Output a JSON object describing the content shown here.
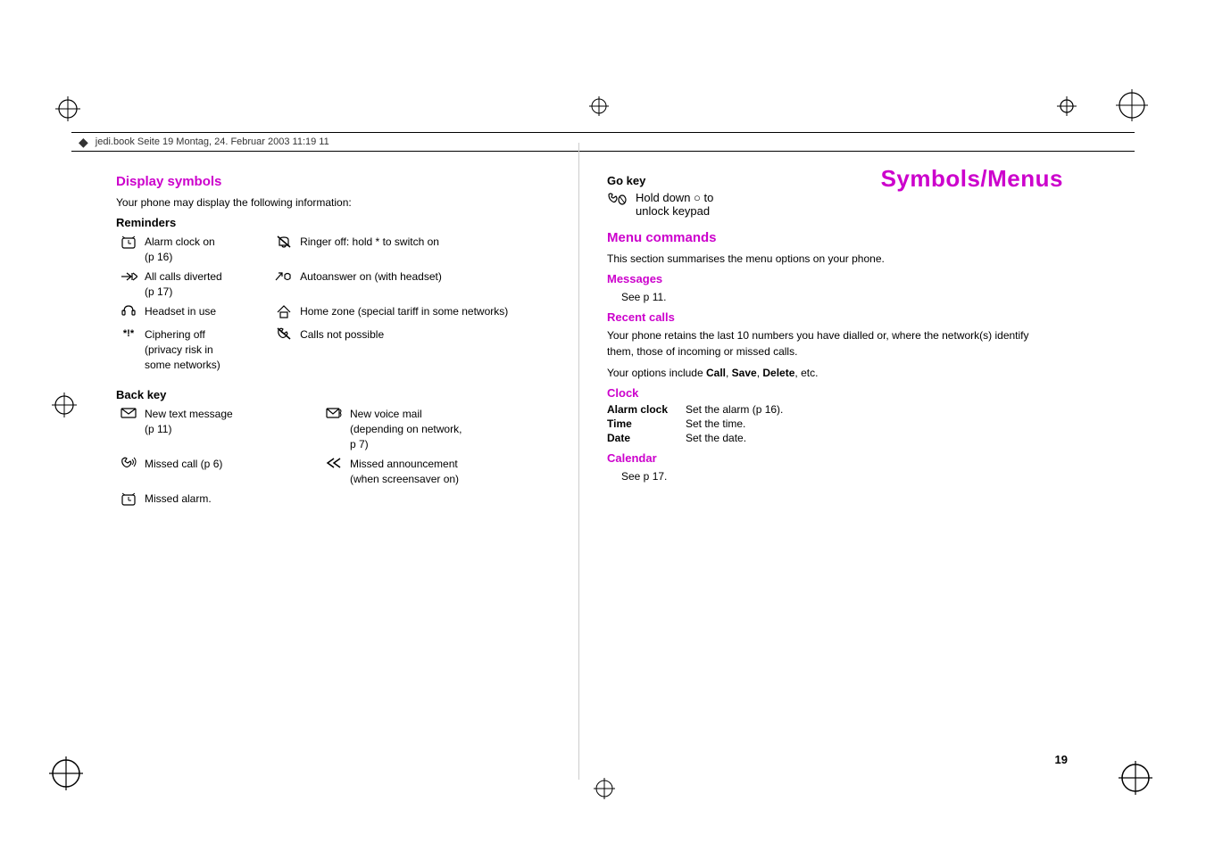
{
  "header": {
    "filename": "jedi.book  Seite 19  Montag, 24. Februar 2003  11:19 11"
  },
  "page_title": "Symbols/Menus",
  "page_number": "19",
  "left": {
    "display_symbols_heading": "Display symbols",
    "intro": "Your phone may display the following information:",
    "reminders_heading": "Reminders",
    "reminders": [
      {
        "icon": "⌚",
        "text": "Alarm clock on\n(p 16)"
      },
      {
        "icon": "✗",
        "text": "Ringer off: hold * to\nswitch on"
      },
      {
        "icon": "↗↗",
        "text": "All calls diverted\n(p 17)"
      },
      {
        "icon": "↗☎",
        "text": "Autoanswer on (with\nheadset)"
      },
      {
        "icon": "🎧",
        "text": "Headset in use"
      },
      {
        "icon": "⌂",
        "text": "Home zone (special tariff\nin some networks)"
      },
      {
        "icon": "*!*",
        "text": "Ciphering off\n(privacy risk in\nsome networks)"
      },
      {
        "icon": "↗",
        "text": "Calls not possible"
      }
    ],
    "backkey_heading": "Back key",
    "backkey": [
      {
        "icon": "✉",
        "text": "New text message\n(p 11)"
      },
      {
        "icon": "✉",
        "text": "New voice mail\n(depending on network,\np 7)"
      },
      {
        "icon": "📵",
        "text": "Missed call (p 6)"
      },
      {
        "icon": "≪",
        "text": "Missed announcement\n(when screensaver on)"
      },
      {
        "icon": "⌚",
        "text": "Missed alarm."
      }
    ]
  },
  "right": {
    "gokey_heading": "Go key",
    "gokey_icon": "r0",
    "gokey_text": "Hold down ○ to\nunlock keypad",
    "menu_commands_heading": "Menu commands",
    "menu_commands_intro": "This section summarises the menu options on your phone.",
    "messages_heading": "Messages",
    "messages_text": "See p 11.",
    "recent_calls_heading": "Recent calls",
    "recent_calls_text1": "Your phone retains the last 10 numbers you have dialled or, where the network(s) identify them, those of incoming or missed calls.",
    "recent_calls_text2": "Your options include Call, Save, Delete, etc.",
    "clock_heading": "Clock",
    "clock_items": [
      {
        "term": "Alarm clock",
        "desc": "Set the alarm (p 16)."
      },
      {
        "term": "Time",
        "desc": "Set the time."
      },
      {
        "term": "Date",
        "desc": "Set the date."
      }
    ],
    "calendar_heading": "Calendar",
    "calendar_text": "See p 17."
  }
}
